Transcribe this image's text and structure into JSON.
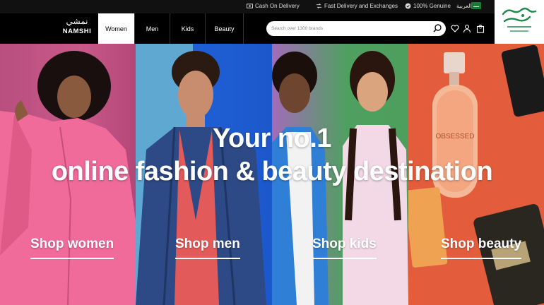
{
  "topbar": {
    "perks": [
      {
        "icon": "cash-icon",
        "label": "Cash On Delivery"
      },
      {
        "icon": "delivery-exchange-icon",
        "label": "Fast Delivery and Exchanges"
      },
      {
        "icon": "genuine-badge-icon",
        "label": "100% Genuine"
      }
    ],
    "language_label": "العربية",
    "country_flag": "saudi-flag-icon"
  },
  "nav": {
    "logo_arabic": "نمشي",
    "logo_english": "NAMSHI",
    "tabs": [
      {
        "label": "Women",
        "active": true
      },
      {
        "label": "Men",
        "active": false
      },
      {
        "label": "Kids",
        "active": false
      },
      {
        "label": "Beauty",
        "active": false
      }
    ],
    "search_placeholder": "Search over 1300 brands",
    "icons": [
      "search-icon",
      "wishlist-heart-icon",
      "account-icon",
      "shopping-bag-icon"
    ],
    "bag_count": "0"
  },
  "hero": {
    "headline_line1": "Your no.1",
    "headline_line2": "online fashion & beauty destination",
    "shop_links": [
      "Shop women",
      "Shop men",
      "Shop kids",
      "Shop beauty"
    ]
  },
  "colors": {
    "women_panel": "#c9598a",
    "men_panel": "#1f5fd6",
    "kids_panel": "#4fa060",
    "beauty_panel": "#e35d3d",
    "active_tab_bg": "#ffffff",
    "nav_bg": "#000000",
    "corner_logo": "#1e8a4a"
  }
}
